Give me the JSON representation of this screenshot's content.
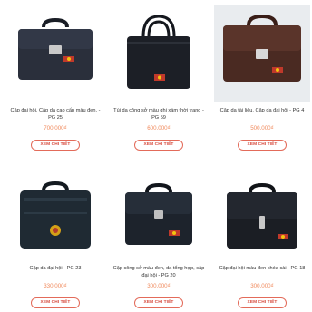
{
  "products": [
    {
      "title": "Cặp đại hội, Cặp da cao cấp màu đen, - PG 25",
      "price": "700.000₫",
      "button": "XEM CHI TIẾT",
      "bag_color": "#2a2f3b",
      "background": "#ffffff"
    },
    {
      "title": "Túi da công sở màu ghi xám thời trang - PG 59",
      "price": "600.000₫",
      "button": "XEM CHI TIẾT",
      "bag_color": "#1c1f26",
      "background": "#ffffff"
    },
    {
      "title": "Cặp da tài liệu, Cặp da đại hội - PG 4",
      "price": "500.000₫",
      "button": "XEM CHI TIẾT",
      "bag_color": "#4a2a22",
      "background": "#e9ecef"
    },
    {
      "title": "Cặp da đại hội - PG 23",
      "price": "330.000₫",
      "button": "XEM CHI TIẾT",
      "bag_color": "#1f2a33",
      "background": "#ffffff"
    },
    {
      "title": "Cặp công sở màu đen, da tổng hợp, cặp đại hội - PG 20",
      "price": "300.000₫",
      "button": "XEM CHI TIẾT",
      "bag_color": "#1d232c",
      "background": "#ffffff"
    },
    {
      "title": "Cặp đại hội màu đen khóa cài - PG 18",
      "price": "300.000₫",
      "button": "XEM CHI TIẾT",
      "bag_color": "#1b1e24",
      "background": "#ffffff"
    }
  ]
}
